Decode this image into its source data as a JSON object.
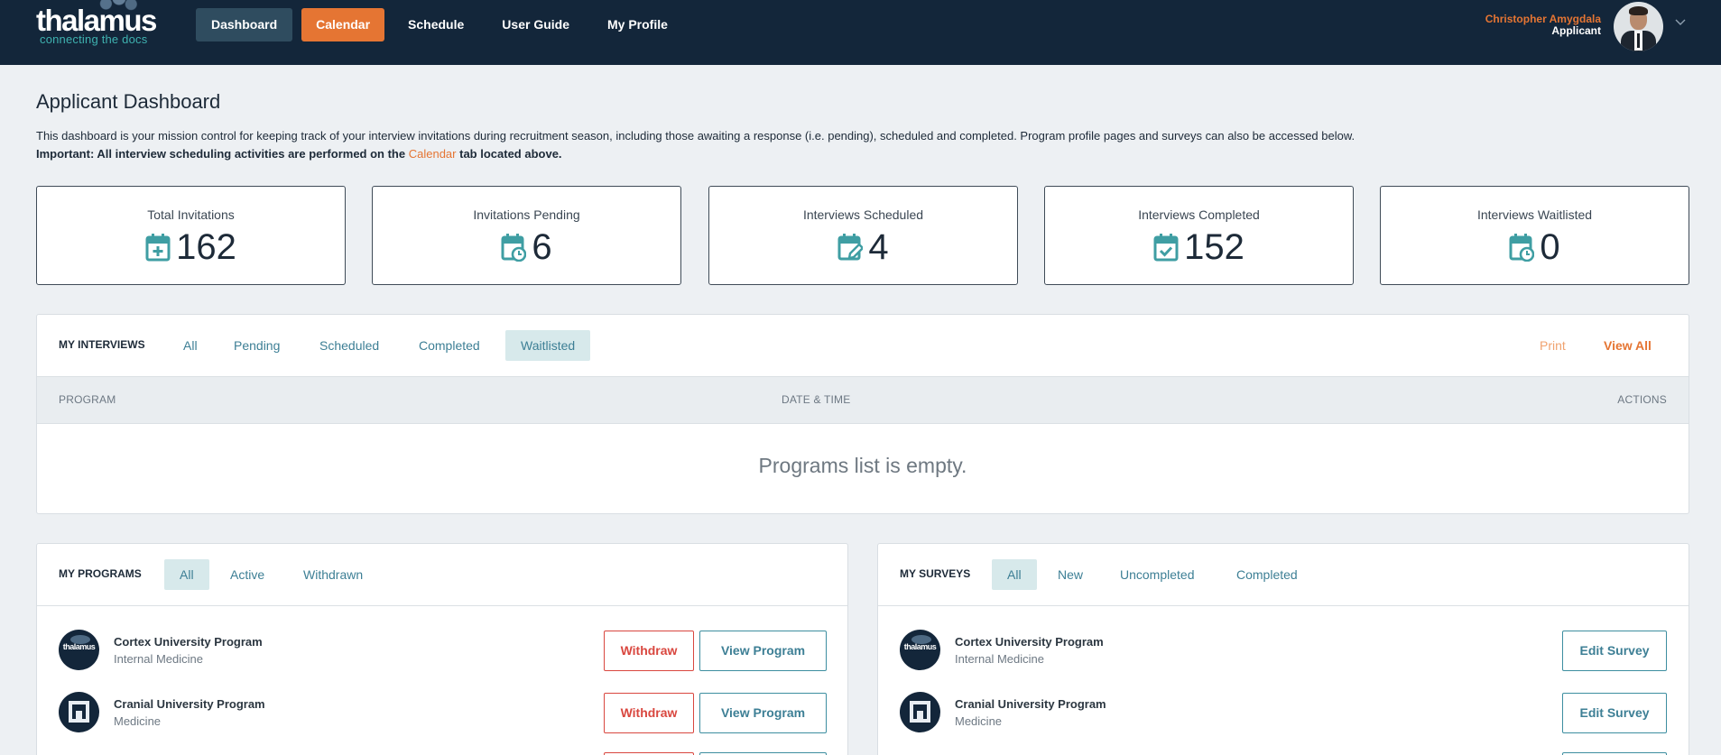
{
  "brand": {
    "name": "thalamus",
    "tagline": "connecting the docs"
  },
  "nav": {
    "items": [
      {
        "label": "Dashboard"
      },
      {
        "label": "Calendar"
      },
      {
        "label": "Schedule"
      },
      {
        "label": "User Guide"
      },
      {
        "label": "My Profile"
      }
    ]
  },
  "user": {
    "name": "Christopher Amygdala",
    "role": "Applicant"
  },
  "page": {
    "title": "Applicant Dashboard",
    "intro": "This dashboard is your mission control for keeping track of your interview invitations during recruitment season, including those awaiting a response (i.e. pending), scheduled and completed. Program profile pages and surveys can also be accessed below.",
    "important_prefix": "Important: All interview scheduling activities are performed on the",
    "important_link": "Calendar",
    "important_suffix": "tab located above."
  },
  "stats": [
    {
      "label": "Total Invitations",
      "value": "162",
      "icon": "calendar-plus-icon"
    },
    {
      "label": "Invitations Pending",
      "value": "6",
      "icon": "calendar-clock-icon"
    },
    {
      "label": "Interviews Scheduled",
      "value": "4",
      "icon": "calendar-edit-icon"
    },
    {
      "label": "Interviews Completed",
      "value": "152",
      "icon": "calendar-check-icon"
    },
    {
      "label": "Interviews Waitlisted",
      "value": "0",
      "icon": "calendar-clock-icon"
    }
  ],
  "interviews": {
    "title": "MY INTERVIEWS",
    "tabs": [
      "All",
      "Pending",
      "Scheduled",
      "Completed",
      "Waitlisted"
    ],
    "selected_tab": "Waitlisted",
    "print_label": "Print",
    "view_all_label": "View All",
    "columns": [
      "PROGRAM",
      "DATE & TIME",
      "ACTIONS"
    ],
    "empty_message": "Programs list is empty."
  },
  "programs": {
    "title": "MY PROGRAMS",
    "tabs": [
      "All",
      "Active",
      "Withdrawn"
    ],
    "selected_tab": "All",
    "withdraw_label": "Withdraw",
    "view_label": "View Program",
    "items": [
      {
        "name": "Cortex University Program",
        "specialty": "Internal Medicine"
      },
      {
        "name": "Cranial University Program",
        "specialty": "Medicine"
      }
    ]
  },
  "surveys": {
    "title": "MY SURVEYS",
    "tabs": [
      "All",
      "New",
      "Uncompleted",
      "Completed"
    ],
    "selected_tab": "All",
    "edit_label": "Edit Survey",
    "items": [
      {
        "name": "Cortex University Program",
        "specialty": "Internal Medicine"
      },
      {
        "name": "Cranial University Program",
        "specialty": "Medicine"
      }
    ]
  },
  "colors": {
    "nav_bg": "#13263a",
    "accent_orange": "#e57533",
    "teal": "#3d7f95",
    "danger": "#d9473f"
  }
}
